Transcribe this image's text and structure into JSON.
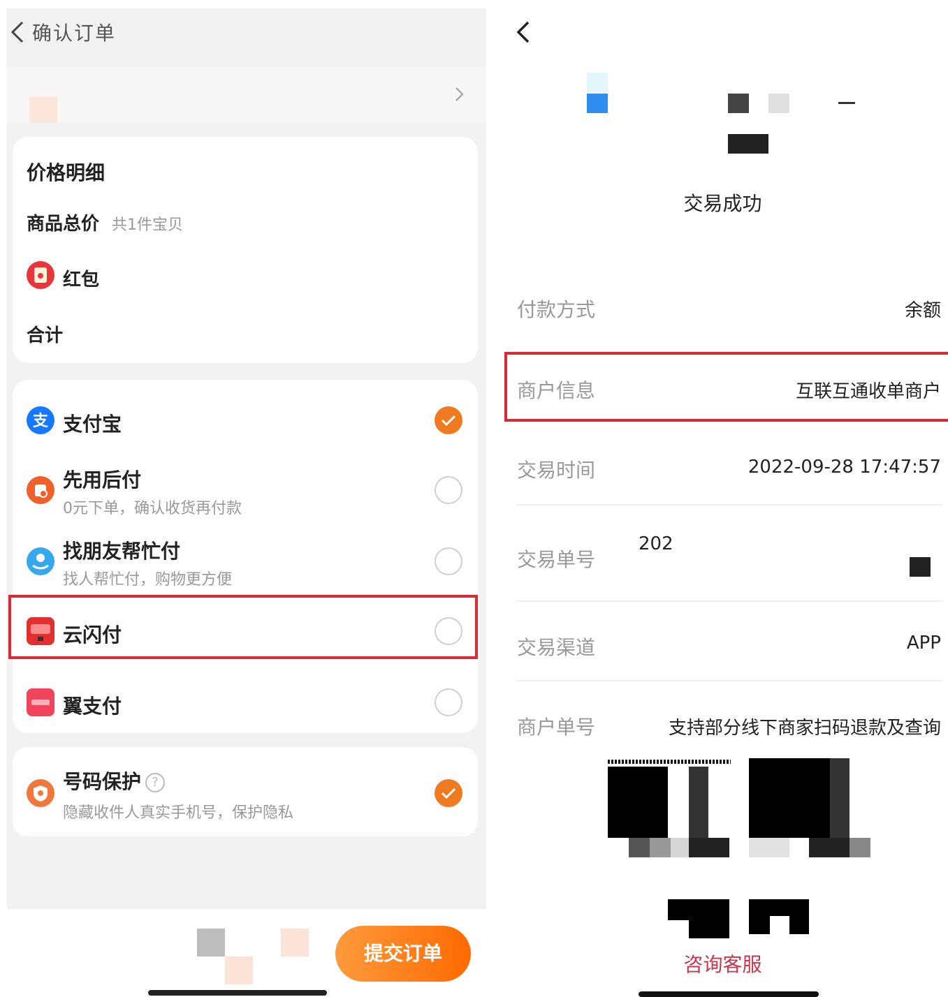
{
  "left": {
    "title": "确认订单",
    "price_detail": {
      "heading": "价格明细",
      "goods_total_label": "商品总价",
      "goods_count": "共1件宝贝",
      "red_packet_label": "红包",
      "total_label": "合计"
    },
    "payment_methods": [
      {
        "label": "支付宝",
        "sub": "",
        "selected": true,
        "icon": "alipay-icon"
      },
      {
        "label": "先用后付",
        "sub": "0元下单，确认收货再付款",
        "selected": false,
        "icon": "pay-later-icon"
      },
      {
        "label": "找朋友帮忙付",
        "sub": "找人帮忙付，购物更方便",
        "selected": false,
        "icon": "friend-pay-icon"
      },
      {
        "label": "云闪付",
        "sub": "",
        "selected": false,
        "icon": "unionpay-icon"
      },
      {
        "label": "翼支付",
        "sub": "",
        "selected": false,
        "icon": "bestpay-icon"
      }
    ],
    "number_protect": {
      "label": "号码保护",
      "help_glyph": "?",
      "sub": "隐藏收件人真实手机号，保护隐私",
      "selected": true
    },
    "submit_label": "提交订单"
  },
  "right": {
    "status": "交易成功",
    "rows": [
      {
        "label": "付款方式",
        "value": "余额"
      },
      {
        "label": "商户信息",
        "value": "互联互通收单商户"
      },
      {
        "label": "交易时间",
        "value": "2022-09-28 17:47:57"
      },
      {
        "label": "交易单号",
        "value": "202"
      },
      {
        "label": "交易渠道",
        "value": "APP"
      },
      {
        "label": "商户单号",
        "value": "支持部分线下商家扫码退款及查询"
      }
    ],
    "consult_label": "咨询客服"
  },
  "colors": {
    "accent_orange": "#f07a1f",
    "highlight_red": "#d92b33",
    "consult_red": "#c9364e"
  }
}
